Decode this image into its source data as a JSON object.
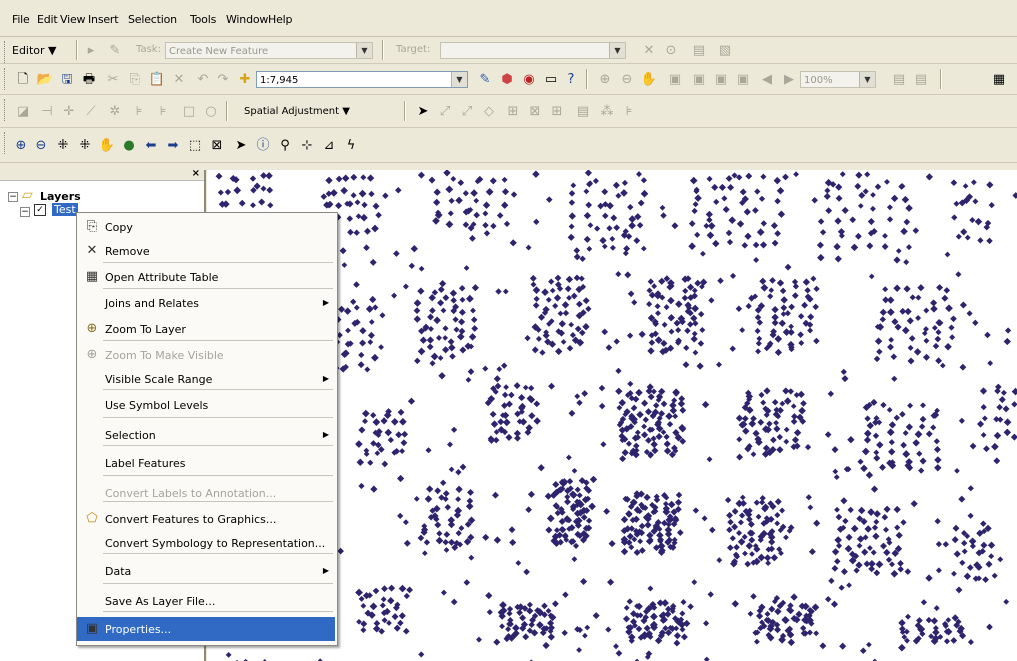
{
  "menubar": {
    "items": [
      "File",
      "Edit",
      "View",
      "Insert",
      "Selection",
      "Tools",
      "Window",
      "Help"
    ]
  },
  "editor_toolbar": {
    "editor_label": "Editor ▼",
    "task_label": "Task:",
    "task_value": "Create New Feature",
    "target_label": "Target:",
    "target_value": ""
  },
  "standard_toolbar": {
    "scale_value": "1:7,945",
    "zoom_value": "100%"
  },
  "spatial_toolbar": {
    "spatial_adjustment_label": "Spatial Adjustment ▼"
  },
  "toc": {
    "root_label": "Layers",
    "layer_label": "Test"
  },
  "context_menu": {
    "items": [
      {
        "label": "Copy"
      },
      {
        "label": "Remove"
      },
      {
        "label": "Open Attribute Table"
      },
      {
        "label": "Joins and Relates"
      },
      {
        "label": "Zoom To Layer"
      },
      {
        "label": "Zoom To Make Visible"
      },
      {
        "label": "Visible Scale Range"
      },
      {
        "label": "Use Symbol Levels"
      },
      {
        "label": "Selection"
      },
      {
        "label": "Label Features"
      },
      {
        "label": "Convert Labels to Annotation..."
      },
      {
        "label": "Convert Features to Graphics..."
      },
      {
        "label": "Convert Symbology to Representation..."
      },
      {
        "label": "Data"
      },
      {
        "label": "Save As Layer File..."
      },
      {
        "label": "Properties..."
      }
    ]
  },
  "colors": {
    "point_color": "#2e246e",
    "highlight": "#316ac5"
  },
  "map": {
    "clusters": [
      [
        0.05,
        0.12,
        0.08,
        0.22,
        45
      ],
      [
        0.18,
        0.08,
        0.07,
        0.18,
        38
      ],
      [
        0.33,
        0.05,
        0.1,
        0.15,
        42
      ],
      [
        0.5,
        0.1,
        0.1,
        0.2,
        50
      ],
      [
        0.66,
        0.08,
        0.12,
        0.18,
        48
      ],
      [
        0.82,
        0.1,
        0.12,
        0.2,
        44
      ],
      [
        0.95,
        0.08,
        0.05,
        0.18,
        20
      ],
      [
        0.18,
        0.35,
        0.06,
        0.14,
        30
      ],
      [
        0.3,
        0.32,
        0.08,
        0.16,
        46
      ],
      [
        0.44,
        0.3,
        0.07,
        0.16,
        52
      ],
      [
        0.58,
        0.3,
        0.07,
        0.16,
        60
      ],
      [
        0.72,
        0.3,
        0.08,
        0.16,
        52
      ],
      [
        0.88,
        0.32,
        0.1,
        0.16,
        46
      ],
      [
        0.22,
        0.55,
        0.06,
        0.12,
        28
      ],
      [
        0.38,
        0.5,
        0.06,
        0.12,
        40
      ],
      [
        0.55,
        0.52,
        0.08,
        0.14,
        85
      ],
      [
        0.7,
        0.52,
        0.08,
        0.14,
        60
      ],
      [
        0.86,
        0.55,
        0.1,
        0.14,
        48
      ],
      [
        0.98,
        0.52,
        0.04,
        0.14,
        18
      ],
      [
        0.3,
        0.72,
        0.06,
        0.14,
        36
      ],
      [
        0.45,
        0.7,
        0.05,
        0.14,
        70
      ],
      [
        0.55,
        0.72,
        0.07,
        0.12,
        90
      ],
      [
        0.68,
        0.74,
        0.07,
        0.14,
        70
      ],
      [
        0.82,
        0.76,
        0.09,
        0.14,
        56
      ],
      [
        0.95,
        0.8,
        0.05,
        0.14,
        26
      ],
      [
        0.22,
        0.9,
        0.06,
        0.1,
        30
      ],
      [
        0.4,
        0.92,
        0.07,
        0.08,
        50
      ],
      [
        0.56,
        0.92,
        0.08,
        0.08,
        60
      ],
      [
        0.72,
        0.92,
        0.08,
        0.08,
        52
      ],
      [
        0.9,
        0.94,
        0.08,
        0.06,
        36
      ]
    ]
  }
}
